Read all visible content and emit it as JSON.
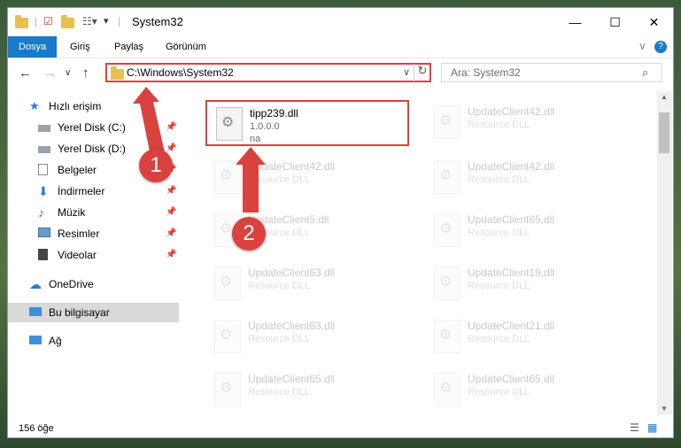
{
  "window": {
    "title": "System32"
  },
  "ribbon": {
    "tabs": [
      "Dosya",
      "Giriş",
      "Paylaş",
      "Görünüm"
    ]
  },
  "window_buttons": {
    "minimize": "—",
    "maximize": "☐",
    "close": "✕"
  },
  "address": {
    "path": "C:\\Windows\\System32",
    "search_placeholder": "Ara: System32"
  },
  "nav": {
    "quick_access": "Hızlı erişim",
    "items": [
      {
        "label": "Yerel Disk (C:)",
        "icon": "drive-icon"
      },
      {
        "label": "Yerel Disk (D:)",
        "icon": "drive-icon"
      },
      {
        "label": "Belgeler",
        "icon": "documents-icon"
      },
      {
        "label": "İndirmeler",
        "icon": "download-icon"
      },
      {
        "label": "Müzik",
        "icon": "music-icon"
      },
      {
        "label": "Resimler",
        "icon": "pictures-icon"
      },
      {
        "label": "Videolar",
        "icon": "videos-icon"
      }
    ],
    "onedrive": "OneDrive",
    "this_pc": "Bu bilgisayar",
    "network": "Ağ"
  },
  "files": {
    "highlighted": {
      "name": "tipp239.dll",
      "version": "1.0.0.0",
      "company": "na"
    },
    "left_column": [
      {
        "name": "UpdateClient42.dll",
        "type": "Resource DLL"
      },
      {
        "name": "UpdateClient5.dll",
        "type": "Resource DLL"
      },
      {
        "name": "UpdateClient63.dll",
        "type": "Resource DLL"
      },
      {
        "name": "UpdateClient63.dll",
        "type": "Resource DLL"
      },
      {
        "name": "UpdateClient65.dll",
        "type": "Resource DLL"
      }
    ],
    "right_column": [
      {
        "name": "UpdateClient42.dll",
        "type": "Resource DLL"
      },
      {
        "name": "UpdateClient42.dll",
        "type": "Resource DLL"
      },
      {
        "name": "UpdateClient65.dll",
        "type": "Resource DLL"
      },
      {
        "name": "UpdateClient19.dll",
        "type": "Resource DLL"
      },
      {
        "name": "UpdateClient21.dll",
        "type": "Resource DLL"
      },
      {
        "name": "UpdateClient65.dll",
        "type": "Resource DLL"
      }
    ]
  },
  "status": {
    "count": "156 öğe"
  },
  "annotations": {
    "step1": "1",
    "step2": "2"
  },
  "colors": {
    "accent": "#1979ca",
    "highlight": "#d9423e"
  }
}
